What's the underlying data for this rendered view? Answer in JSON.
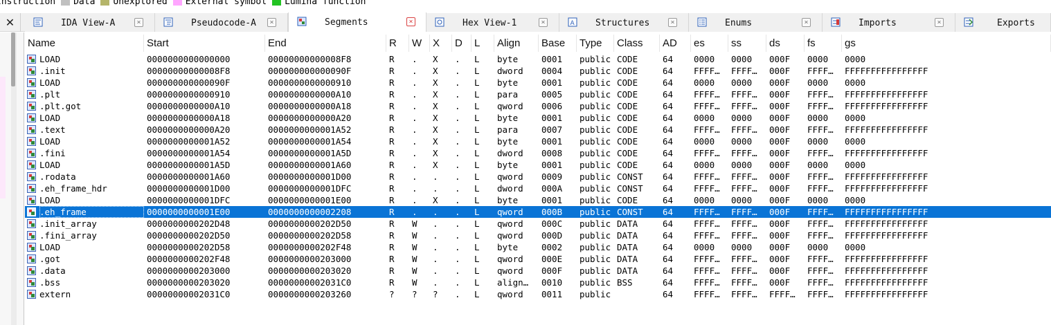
{
  "legend": {
    "items": [
      {
        "label": "Instruction",
        "color": null
      },
      {
        "label": "Data",
        "color": "#c0c0c0"
      },
      {
        "label": "Unexplored",
        "color": "#b5b56a"
      },
      {
        "label": "External symbol",
        "color": "#ffa6ff"
      },
      {
        "label": "Lumina function",
        "color": "#22c322"
      }
    ]
  },
  "tabs": [
    {
      "label": "IDA View-A",
      "icon": "disassembly-icon",
      "active": false
    },
    {
      "label": "Pseudocode-A",
      "icon": "pseudocode-icon",
      "active": false
    },
    {
      "label": "Segments",
      "icon": "segments-icon",
      "active": true
    },
    {
      "label": "Hex View-1",
      "icon": "hex-icon",
      "active": false
    },
    {
      "label": "Structures",
      "icon": "structures-icon",
      "active": false
    },
    {
      "label": "Enums",
      "icon": "enums-icon",
      "active": false
    },
    {
      "label": "Imports",
      "icon": "imports-icon",
      "active": false
    },
    {
      "label": "Exports",
      "icon": "exports-icon",
      "active": false
    }
  ],
  "close_panel_symbol": "✕",
  "tab_close_symbol": "×",
  "table": {
    "columns": [
      "Name",
      "Start",
      "End",
      "R",
      "W",
      "X",
      "D",
      "L",
      "Align",
      "Base",
      "Type",
      "Class",
      "AD",
      "es",
      "ss",
      "ds",
      "fs",
      "gs"
    ],
    "selected_index": 13,
    "rows": [
      [
        "LOAD",
        "0000000000000000",
        "00000000000008F8",
        "R",
        ".",
        "X",
        ".",
        "L",
        "byte",
        "0001",
        "public",
        "CODE",
        "64",
        "0000",
        "0000",
        "000F",
        "0000",
        "0000"
      ],
      [
        ".init",
        "00000000000008F8",
        "000000000000090F",
        "R",
        ".",
        "X",
        ".",
        "L",
        "dword",
        "0004",
        "public",
        "CODE",
        "64",
        "FFFF…",
        "FFFF…",
        "000F",
        "FFFF…",
        "FFFFFFFFFFFFFFFF"
      ],
      [
        "LOAD",
        "000000000000090F",
        "0000000000000910",
        "R",
        ".",
        "X",
        ".",
        "L",
        "byte",
        "0001",
        "public",
        "CODE",
        "64",
        "0000",
        "0000",
        "000F",
        "0000",
        "0000"
      ],
      [
        ".plt",
        "0000000000000910",
        "0000000000000A10",
        "R",
        ".",
        "X",
        ".",
        "L",
        "para",
        "0005",
        "public",
        "CODE",
        "64",
        "FFFF…",
        "FFFF…",
        "000F",
        "FFFF…",
        "FFFFFFFFFFFFFFFF"
      ],
      [
        ".plt.got",
        "0000000000000A10",
        "0000000000000A18",
        "R",
        ".",
        "X",
        ".",
        "L",
        "qword",
        "0006",
        "public",
        "CODE",
        "64",
        "FFFF…",
        "FFFF…",
        "000F",
        "FFFF…",
        "FFFFFFFFFFFFFFFF"
      ],
      [
        "LOAD",
        "0000000000000A18",
        "0000000000000A20",
        "R",
        ".",
        "X",
        ".",
        "L",
        "byte",
        "0001",
        "public",
        "CODE",
        "64",
        "0000",
        "0000",
        "000F",
        "0000",
        "0000"
      ],
      [
        ".text",
        "0000000000000A20",
        "0000000000001A52",
        "R",
        ".",
        "X",
        ".",
        "L",
        "para",
        "0007",
        "public",
        "CODE",
        "64",
        "FFFF…",
        "FFFF…",
        "000F",
        "FFFF…",
        "FFFFFFFFFFFFFFFF"
      ],
      [
        "LOAD",
        "0000000000001A52",
        "0000000000001A54",
        "R",
        ".",
        "X",
        ".",
        "L",
        "byte",
        "0001",
        "public",
        "CODE",
        "64",
        "0000",
        "0000",
        "000F",
        "0000",
        "0000"
      ],
      [
        ".fini",
        "0000000000001A54",
        "0000000000001A5D",
        "R",
        ".",
        "X",
        ".",
        "L",
        "dword",
        "0008",
        "public",
        "CODE",
        "64",
        "FFFF…",
        "FFFF…",
        "000F",
        "FFFF…",
        "FFFFFFFFFFFFFFFF"
      ],
      [
        "LOAD",
        "0000000000001A5D",
        "0000000000001A60",
        "R",
        ".",
        "X",
        ".",
        "L",
        "byte",
        "0001",
        "public",
        "CODE",
        "64",
        "0000",
        "0000",
        "000F",
        "0000",
        "0000"
      ],
      [
        ".rodata",
        "0000000000001A60",
        "0000000000001D00",
        "R",
        ".",
        ".",
        ".",
        "L",
        "qword",
        "0009",
        "public",
        "CONST",
        "64",
        "FFFF…",
        "FFFF…",
        "000F",
        "FFFF…",
        "FFFFFFFFFFFFFFFF"
      ],
      [
        ".eh_frame_hdr",
        "0000000000001D00",
        "0000000000001DFC",
        "R",
        ".",
        ".",
        ".",
        "L",
        "dword",
        "000A",
        "public",
        "CONST",
        "64",
        "FFFF…",
        "FFFF…",
        "000F",
        "FFFF…",
        "FFFFFFFFFFFFFFFF"
      ],
      [
        "LOAD",
        "0000000000001DFC",
        "0000000000001E00",
        "R",
        ".",
        "X",
        ".",
        "L",
        "byte",
        "0001",
        "public",
        "CODE",
        "64",
        "0000",
        "0000",
        "000F",
        "0000",
        "0000"
      ],
      [
        ".eh_frame",
        "0000000000001E00",
        "0000000000002208",
        "R",
        ".",
        ".",
        ".",
        "L",
        "qword",
        "000B",
        "public",
        "CONST",
        "64",
        "FFFF…",
        "FFFF…",
        "000F",
        "FFFF…",
        "FFFFFFFFFFFFFFFF"
      ],
      [
        ".init_array",
        "0000000000202D48",
        "0000000000202D50",
        "R",
        "W",
        ".",
        ".",
        "L",
        "qword",
        "000C",
        "public",
        "DATA",
        "64",
        "FFFF…",
        "FFFF…",
        "000F",
        "FFFF…",
        "FFFFFFFFFFFFFFFF"
      ],
      [
        ".fini_array",
        "0000000000202D50",
        "0000000000202D58",
        "R",
        "W",
        ".",
        ".",
        "L",
        "qword",
        "000D",
        "public",
        "DATA",
        "64",
        "FFFF…",
        "FFFF…",
        "000F",
        "FFFF…",
        "FFFFFFFFFFFFFFFF"
      ],
      [
        "LOAD",
        "0000000000202D58",
        "0000000000202F48",
        "R",
        "W",
        ".",
        ".",
        "L",
        "byte",
        "0002",
        "public",
        "DATA",
        "64",
        "0000",
        "0000",
        "000F",
        "0000",
        "0000"
      ],
      [
        ".got",
        "0000000000202F48",
        "0000000000203000",
        "R",
        "W",
        ".",
        ".",
        "L",
        "qword",
        "000E",
        "public",
        "DATA",
        "64",
        "FFFF…",
        "FFFF…",
        "000F",
        "FFFF…",
        "FFFFFFFFFFFFFFFF"
      ],
      [
        ".data",
        "0000000000203000",
        "0000000000203020",
        "R",
        "W",
        ".",
        ".",
        "L",
        "qword",
        "000F",
        "public",
        "DATA",
        "64",
        "FFFF…",
        "FFFF…",
        "000F",
        "FFFF…",
        "FFFFFFFFFFFFFFFF"
      ],
      [
        ".bss",
        "0000000000203020",
        "00000000002031C0",
        "R",
        "W",
        ".",
        ".",
        "L",
        "align…",
        "0010",
        "public",
        "BSS",
        "64",
        "FFFF…",
        "FFFF…",
        "000F",
        "FFFF…",
        "FFFFFFFFFFFFFFFF"
      ],
      [
        "extern",
        "00000000002031C0",
        "0000000000203260",
        "?",
        "?",
        "?",
        ".",
        "L",
        "qword",
        "0011",
        "public",
        "",
        "64",
        "FFFF…",
        "FFFF…",
        "FFFF…",
        "FFFF…",
        "FFFFFFFFFFFFFFFF"
      ]
    ]
  }
}
